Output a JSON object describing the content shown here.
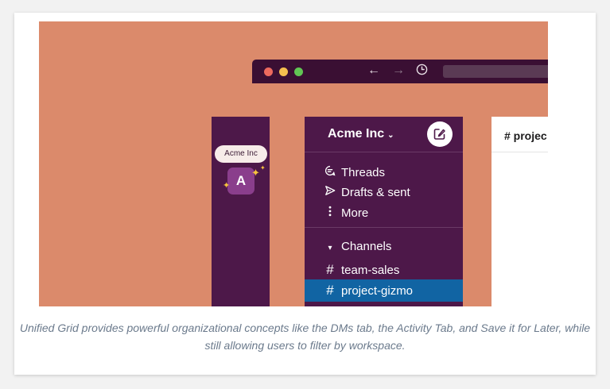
{
  "browser": {
    "back_icon": "←",
    "forward_icon": "→",
    "history_icon": "⟲"
  },
  "workspace": {
    "tooltip": "Acme Inc",
    "avatar_letter": "A",
    "sparkle_glyph": "✦"
  },
  "sidebar": {
    "title": "Acme Inc",
    "title_chevron": "⌄",
    "compose_icon": "compose-icon",
    "nav_items": [
      {
        "label": "Threads",
        "icon": "threads-icon"
      },
      {
        "label": "Drafts & sent",
        "icon": "send-icon"
      },
      {
        "label": "More",
        "icon": "more-vertical-icon"
      }
    ],
    "channels_header": "Channels",
    "channels_caret": "▾",
    "channels": [
      {
        "label": "team-sales",
        "active": false
      },
      {
        "label": "project-gizmo",
        "active": true
      }
    ],
    "hash_glyph": "#"
  },
  "main": {
    "title": "# projec"
  },
  "caption": "Unified Grid provides powerful organizational concepts like the DMs tab, the Activity Tab, and Save it for Later, while still allowing users to filter by workspace.",
  "colors": {
    "background": "#db8a6b",
    "aubergine": "#4d1849",
    "active_channel": "#1164a3"
  }
}
